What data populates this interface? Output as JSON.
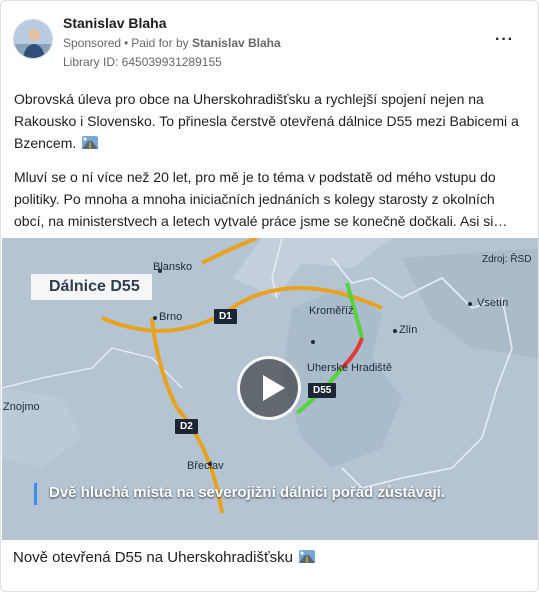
{
  "post": {
    "author": "Stanislav Blaha",
    "sponsored": "Sponsored",
    "paid_prefix": "Paid for by",
    "paid_by": "Stanislav Blaha",
    "library_id": "Library ID: 645039931289155",
    "paragraph1": "Obrovská úleva pro obce na Uherskohradišťsku a rychlejší spojení nejen na Rakousko i Slovensko. To přinesla čerstvě otevřená dálnice D55 mezi Babicemi a Bzencem.",
    "paragraph2": "Mluví se o ní více než 20 let, pro mě je to téma v podstatě od mého vstupu do politiky. Po mnoha a mnoha iniciačních jednáních s kolegy starosty z okolních obcí, na ministerstvech a letech vytvalé práce jsme se konečně dočkali. Asi si…",
    "emoji_icon": "highway-emoji-icon",
    "bottom_caption": "Nově otevřená D55 na Uherskohradišťsku"
  },
  "video": {
    "map_title": "Dálnice D55",
    "source": "Zdroj: ŘSD",
    "subtitle": "Dvě hluchá místa na severojižní dálnici pořád zůstávají.",
    "road_labels": [
      "D1",
      "D2",
      "D55"
    ],
    "places": [
      "Blansko",
      "Brno",
      "Kroměříž",
      "Zlín",
      "Uherské Hradiště",
      "Vsetín",
      "Znojmo",
      "Břeclav"
    ],
    "colors": {
      "motorway": "#e8a21e",
      "new_section": "#56d23a",
      "gap_section": "#e53935",
      "accent": "#3d8bfd"
    }
  }
}
